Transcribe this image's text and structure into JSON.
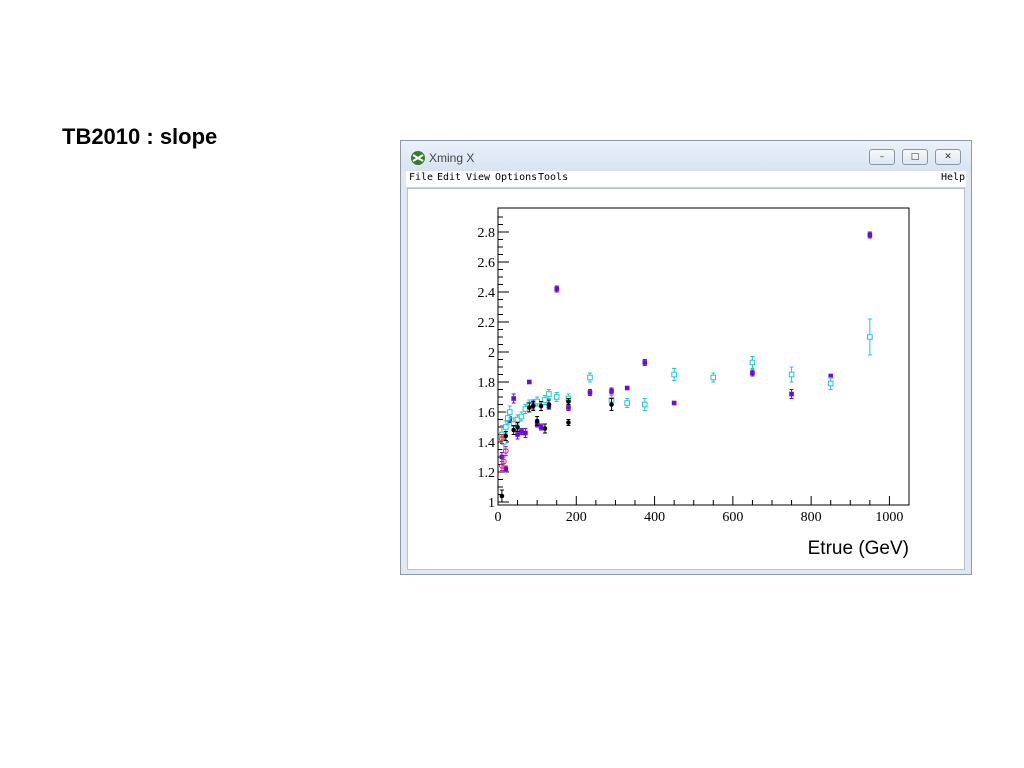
{
  "slide": {
    "title": "TB2010 : slope"
  },
  "window": {
    "title": "Xming X",
    "menu": [
      "File",
      "Edit",
      "View",
      "Options",
      "Tools"
    ],
    "menu_help": "Help",
    "buttons": {
      "minimize": "–",
      "maximize": "□",
      "close": "✕"
    }
  },
  "chart_data": {
    "type": "scatter",
    "title": "",
    "xlabel": "Etrue (GeV)",
    "ylabel": "",
    "xlim": [
      0,
      1050
    ],
    "ylim": [
      0.98,
      2.96
    ],
    "xticks": [
      0,
      200,
      400,
      600,
      800,
      1000
    ],
    "yticks": [
      1,
      1.2,
      1.4,
      1.6,
      1.8,
      2,
      2.2,
      2.4,
      2.6,
      2.8
    ],
    "ytick_labels": [
      "1",
      "1.2",
      "1.4",
      "1.6",
      "1.8",
      "2",
      "2.2",
      "2.4",
      "2.6",
      "2.8"
    ],
    "grid": false,
    "series": [
      {
        "color": "#6a0dd8",
        "marker": "filled-square",
        "points": [
          {
            "x": 10,
            "y": 1.3,
            "e": 0.03
          },
          {
            "x": 20,
            "y": 1.22,
            "e": 0.02
          },
          {
            "x": 30,
            "y": 1.55,
            "e": 0.02
          },
          {
            "x": 40,
            "y": 1.69,
            "e": 0.03
          },
          {
            "x": 50,
            "y": 1.45,
            "e": 0.03
          },
          {
            "x": 60,
            "y": 1.47,
            "e": 0.02
          },
          {
            "x": 70,
            "y": 1.46,
            "e": 0.03
          },
          {
            "x": 80,
            "y": 1.8,
            "e": 0.01
          },
          {
            "x": 90,
            "y": 1.65,
            "e": 0.03
          },
          {
            "x": 100,
            "y": 1.52,
            "e": 0.02
          },
          {
            "x": 110,
            "y": 1.5,
            "e": 0.02
          },
          {
            "x": 130,
            "y": 1.64,
            "e": 0.02
          },
          {
            "x": 150,
            "y": 2.42,
            "e": 0.02
          },
          {
            "x": 180,
            "y": 1.63,
            "e": 0.02
          },
          {
            "x": 235,
            "y": 1.73,
            "e": 0.02
          },
          {
            "x": 290,
            "y": 1.74,
            "e": 0.02
          },
          {
            "x": 330,
            "y": 1.76,
            "e": 0.01
          },
          {
            "x": 375,
            "y": 1.93,
            "e": 0.02
          },
          {
            "x": 450,
            "y": 1.66,
            "e": 0.01
          },
          {
            "x": 650,
            "y": 1.86,
            "e": 0.02
          },
          {
            "x": 750,
            "y": 1.72,
            "e": 0.03
          },
          {
            "x": 850,
            "y": 1.84,
            "e": 0.01
          },
          {
            "x": 950,
            "y": 2.78,
            "e": 0.02
          }
        ]
      },
      {
        "color": "#1fc7d4",
        "marker": "open-square",
        "points": [
          {
            "x": 10,
            "y": 1.45,
            "e": 0.06
          },
          {
            "x": 15,
            "y": 1.4,
            "e": 0.05
          },
          {
            "x": 20,
            "y": 1.5,
            "e": 0.04
          },
          {
            "x": 25,
            "y": 1.56,
            "e": 0.04
          },
          {
            "x": 30,
            "y": 1.6,
            "e": 0.04
          },
          {
            "x": 40,
            "y": 1.52,
            "e": 0.04
          },
          {
            "x": 50,
            "y": 1.55,
            "e": 0.03
          },
          {
            "x": 60,
            "y": 1.57,
            "e": 0.03
          },
          {
            "x": 70,
            "y": 1.62,
            "e": 0.03
          },
          {
            "x": 80,
            "y": 1.65,
            "e": 0.03
          },
          {
            "x": 100,
            "y": 1.67,
            "e": 0.03
          },
          {
            "x": 120,
            "y": 1.68,
            "e": 0.03
          },
          {
            "x": 130,
            "y": 1.72,
            "e": 0.03
          },
          {
            "x": 150,
            "y": 1.7,
            "e": 0.03
          },
          {
            "x": 180,
            "y": 1.69,
            "e": 0.03
          },
          {
            "x": 235,
            "y": 1.83,
            "e": 0.03
          },
          {
            "x": 290,
            "y": 1.68,
            "e": 0.03
          },
          {
            "x": 330,
            "y": 1.66,
            "e": 0.03
          },
          {
            "x": 375,
            "y": 1.65,
            "e": 0.04
          },
          {
            "x": 450,
            "y": 1.85,
            "e": 0.04
          },
          {
            "x": 550,
            "y": 1.83,
            "e": 0.03
          },
          {
            "x": 650,
            "y": 1.93,
            "e": 0.04
          },
          {
            "x": 750,
            "y": 1.85,
            "e": 0.05
          },
          {
            "x": 850,
            "y": 1.79,
            "e": 0.04
          },
          {
            "x": 950,
            "y": 2.1,
            "e": 0.12
          }
        ]
      },
      {
        "color": "#000000",
        "marker": "filled-circle",
        "points": [
          {
            "x": 10,
            "y": 1.04,
            "e": 0.04
          },
          {
            "x": 20,
            "y": 1.44,
            "e": 0.03
          },
          {
            "x": 40,
            "y": 1.48,
            "e": 0.03
          },
          {
            "x": 50,
            "y": 1.5,
            "e": 0.03
          },
          {
            "x": 80,
            "y": 1.63,
            "e": 0.03
          },
          {
            "x": 90,
            "y": 1.64,
            "e": 0.03
          },
          {
            "x": 100,
            "y": 1.54,
            "e": 0.03
          },
          {
            "x": 110,
            "y": 1.64,
            "e": 0.03
          },
          {
            "x": 120,
            "y": 1.49,
            "e": 0.03
          },
          {
            "x": 130,
            "y": 1.65,
            "e": 0.03
          },
          {
            "x": 180,
            "y": 1.53,
            "e": 0.02
          },
          {
            "x": 180,
            "y": 1.67,
            "e": 0.02
          },
          {
            "x": 290,
            "y": 1.65,
            "e": 0.04
          }
        ]
      },
      {
        "color": "#e0208a",
        "marker": "open-circle",
        "points": [
          {
            "x": 10,
            "y": 1.24,
            "e": 0.03
          },
          {
            "x": 15,
            "y": 1.27,
            "e": 0.03
          },
          {
            "x": 20,
            "y": 1.34,
            "e": 0.03
          }
        ]
      },
      {
        "color": "#d42020",
        "marker": "open-circle",
        "points": [
          {
            "x": 10,
            "y": 1.42,
            "e": 0.03
          }
        ]
      }
    ]
  }
}
